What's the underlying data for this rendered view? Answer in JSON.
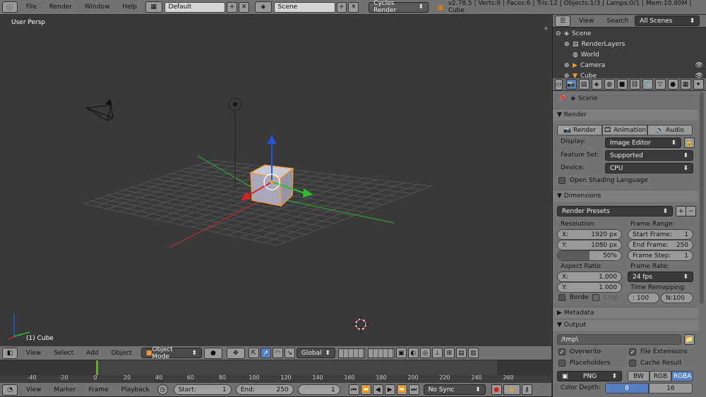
{
  "topbar": {
    "menus": [
      "File",
      "Render",
      "Window",
      "Help"
    ],
    "layout": "Default",
    "scene": "Scene",
    "engine": "Cycles Render",
    "stats": "v2.78.5 | Verts:8 | Faces:6 | Tris:12 | Objects:1/3 | Lamps:0/1 | Mem:10.80M | Cube"
  },
  "viewport": {
    "label": "User Persp",
    "object_label": "(1) Cube"
  },
  "view3d_header": {
    "menus": [
      "View",
      "Select",
      "Add",
      "Object"
    ],
    "mode": "Object Mode",
    "orientation": "Global"
  },
  "timeline": {
    "ticks": [
      "-40",
      "-20",
      "0",
      "20",
      "40",
      "60",
      "80",
      "100",
      "120",
      "140",
      "160",
      "180",
      "200",
      "220",
      "240",
      "260"
    ],
    "current_frame_value": 1
  },
  "timeline_header": {
    "menus": [
      "View",
      "Marker",
      "Frame",
      "Playback"
    ],
    "start_label": "Start:",
    "start": "1",
    "end_label": "End:",
    "end": "250",
    "current": "1",
    "sync": "No Sync"
  },
  "outliner": {
    "menus": [
      "View",
      "Search"
    ],
    "filter": "All Scenes",
    "items": [
      "Scene",
      "RenderLayers",
      "World",
      "Camera",
      "Cube"
    ]
  },
  "properties": {
    "context": "Scene",
    "render_panel": "Render",
    "render_buttons": [
      "Render",
      "Animation",
      "Audio"
    ],
    "display_label": "Display:",
    "display": "Image Editor",
    "feature_label": "Feature Set:",
    "feature": "Supported",
    "device_label": "Device:",
    "device": "CPU",
    "osl": "Open Shading Language",
    "dimensions_panel": "Dimensions",
    "presets": "Render Presets",
    "resolution_label": "Resolution:",
    "res_x_label": "X:",
    "res_x": "1920 px",
    "res_y_label": "Y:",
    "res_y": "1080 px",
    "res_pct": "50%",
    "res_pct_value": 50,
    "frame_range_label": "Frame Range:",
    "start_frame_label": "Start Frame:",
    "start_frame": "1",
    "end_frame_label": "End Frame:",
    "end_frame": "250",
    "frame_step_label": "Frame Step:",
    "frame_step": "1",
    "aspect_label": "Aspect Ratio:",
    "aspect_x_label": "X:",
    "aspect_x": "1.000",
    "aspect_y_label": "Y:",
    "aspect_y": "1.000",
    "frame_rate_label": "Frame Rate:",
    "frame_rate": "24 fps",
    "time_remap_label": "Time Remapping:",
    "time_old": ": 100",
    "time_new": "N:100",
    "border": "Borde",
    "crop": "Crop",
    "metadata_panel": "Metadata",
    "output_panel": "Output",
    "output_path": "/tmp\\",
    "overwrite": "Overwrite",
    "file_ext": "File Extensions",
    "placeholders": "Placeholders",
    "cache": "Cache Result",
    "format": "PNG",
    "color_modes": [
      "BW",
      "RGB",
      "RGBA"
    ],
    "color_depth_label": "Color Depth:",
    "depths": [
      "8",
      "16"
    ]
  },
  "colors": {
    "selected": "#5680c2",
    "x_axis": "#cc3333",
    "y_axis": "#33aa33",
    "z_axis": "#2255dd"
  }
}
